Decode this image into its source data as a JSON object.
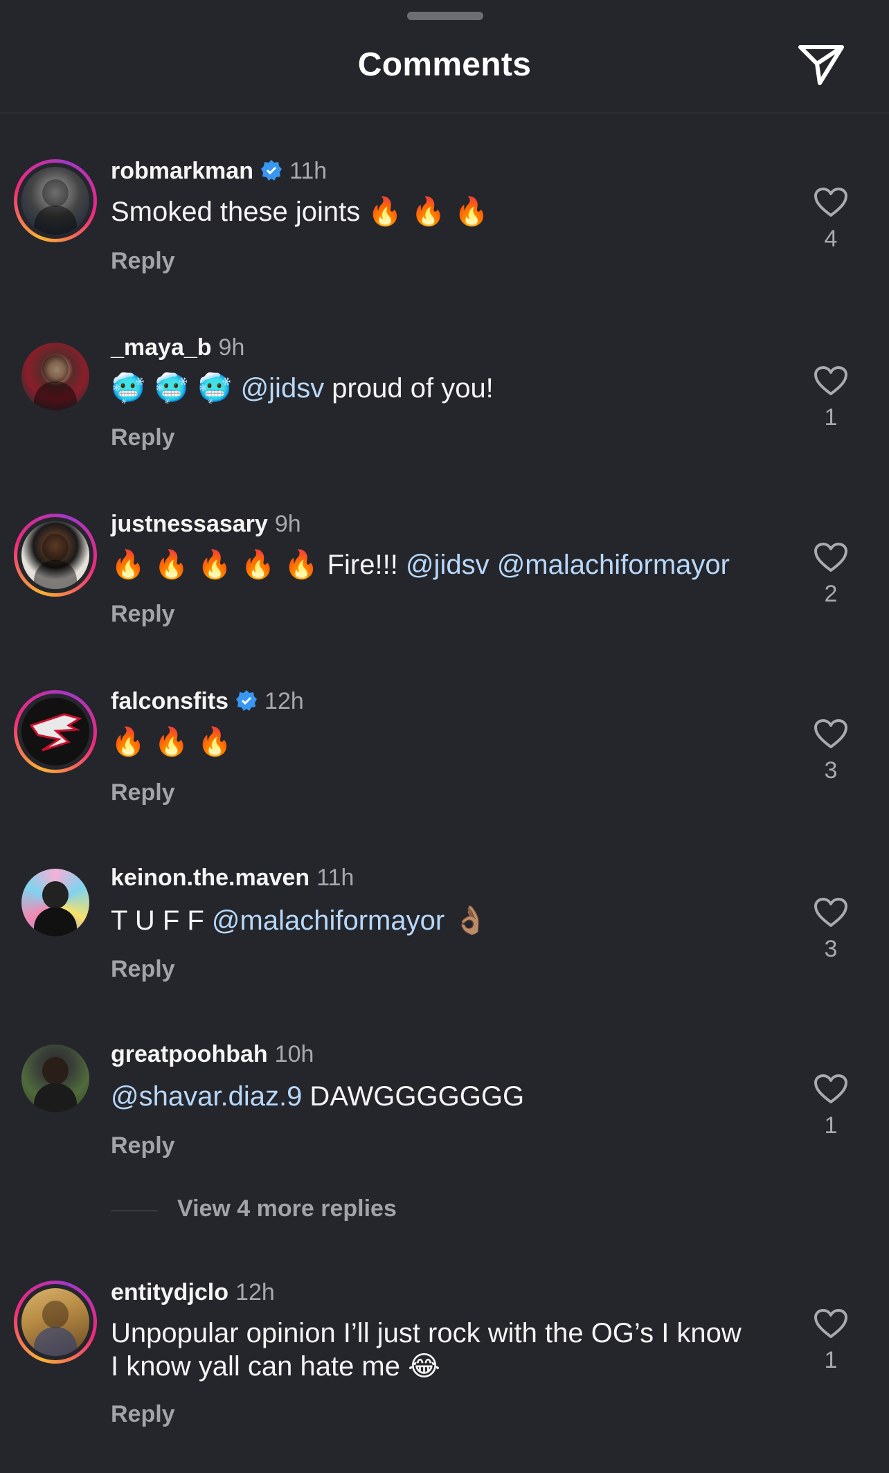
{
  "header": {
    "title": "Comments"
  },
  "comments": [
    {
      "username": "robmarkman",
      "verified": true,
      "time": "11h",
      "text_parts": [
        "Smoked these joints ",
        "🔥 🔥 🔥"
      ],
      "reply": "Reply",
      "likes": "4"
    },
    {
      "username": "_maya_b",
      "verified": false,
      "time": "9h",
      "text_parts": [
        "🥶 🥶 🥶 ",
        "@jidsv",
        " proud of you!"
      ],
      "reply": "Reply",
      "likes": "1"
    },
    {
      "username": "justnessasary",
      "verified": false,
      "time": "9h",
      "text_parts": [
        "🔥 🔥 🔥 🔥 🔥 ",
        "Fire!!! ",
        "@jidsv",
        " ",
        "@malachiformayor"
      ],
      "reply": "Reply",
      "likes": "2"
    },
    {
      "username": "falconsfits",
      "verified": true,
      "time": "12h",
      "text_parts": [
        "🔥 🔥 🔥"
      ],
      "reply": "Reply",
      "likes": "3"
    },
    {
      "username": "keinon.the.maven",
      "verified": false,
      "time": "11h",
      "text_parts": [
        "T U F F ",
        "@malachiformayor",
        " 👌🏽"
      ],
      "reply": "Reply",
      "likes": "3"
    },
    {
      "username": "greatpoohbah",
      "verified": false,
      "time": "10h",
      "text_parts": [
        "@shavar.diaz.9",
        " DAWGGGGGGG"
      ],
      "reply": "Reply",
      "likes": "1"
    },
    {
      "username": "entitydjclo",
      "verified": false,
      "time": "12h",
      "text_parts": [
        "Unpopular opinion I’ll just rock with the OG’s I know I know yall can hate me ",
        "😂"
      ],
      "reply": "Reply",
      "likes": "1"
    }
  ],
  "view_more": {
    "label": "View 4 more replies"
  },
  "colors": {
    "background": "#25262b",
    "mention": "#b7d8fb",
    "muted": "#a3a4a8",
    "verified": "#3897f0"
  },
  "icons": [
    "share-icon",
    "verified-badge-icon",
    "heart-icon"
  ]
}
